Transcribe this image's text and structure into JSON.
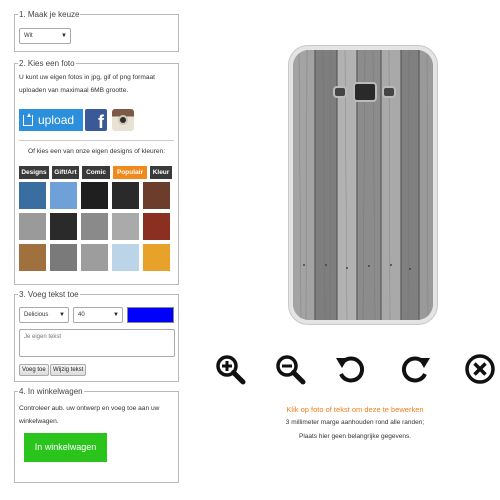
{
  "step1": {
    "legend": "1. Maak je keuze",
    "color_select": "Wit"
  },
  "step2": {
    "legend": "2. Kies een foto",
    "upload_info": "U kunt uw eigen fotos in jpg, gif of png formaat uploaden van maximaal 6MB grootte.",
    "upload_button": "upload",
    "facebook_icon": "facebook-icon",
    "instagram_icon": "instagram-icon",
    "designs_intro": "Of kies een van onze eigen designs of kleuren:",
    "tabs": [
      "Designs",
      "Gift/Art",
      "Comic",
      "Populair",
      "Kleur"
    ],
    "active_tab": "Populair",
    "thumb_colors": [
      [
        "#3a6ea0",
        "#6fa0d8",
        "#1f1f1f",
        "#2a2a2a",
        "#6b3d2a"
      ],
      [
        "#9a9a9a",
        "#2a2a2a",
        "#8a8a8a",
        "#aaaaaa",
        "#8b2f22"
      ],
      [
        "#a0703f",
        "#7a7a7a",
        "#9d9d9d",
        "#bcd4e8",
        "#e8a22a"
      ]
    ]
  },
  "step3": {
    "legend": "3. Voeg tekst toe",
    "font_select": "Delicious",
    "size_select": "40",
    "text_color": "#0000ff",
    "text_placeholder": "Je eigen tekst",
    "add_button": "Voeg toe",
    "edit_button": "Wijzig tekst"
  },
  "step4": {
    "legend": "4. In winkelwagen",
    "info": "Controleer aub. uw ontwerp en voeg toe aan uw winkelwagen.",
    "cart_button": "In winkelwagen",
    "cart_color": "#2bc41d"
  },
  "tools": [
    "zoom-in-icon",
    "zoom-out-icon",
    "rotate-left-icon",
    "rotate-right-icon",
    "delete-icon"
  ],
  "hints": {
    "edit_hint": "Klik op foto of tekst om deze te bewerken",
    "margin_hint": "3 millimeter marge aanhouden rond alle randen;",
    "data_hint": "Plaats hier geen belangrijke gegevens."
  }
}
